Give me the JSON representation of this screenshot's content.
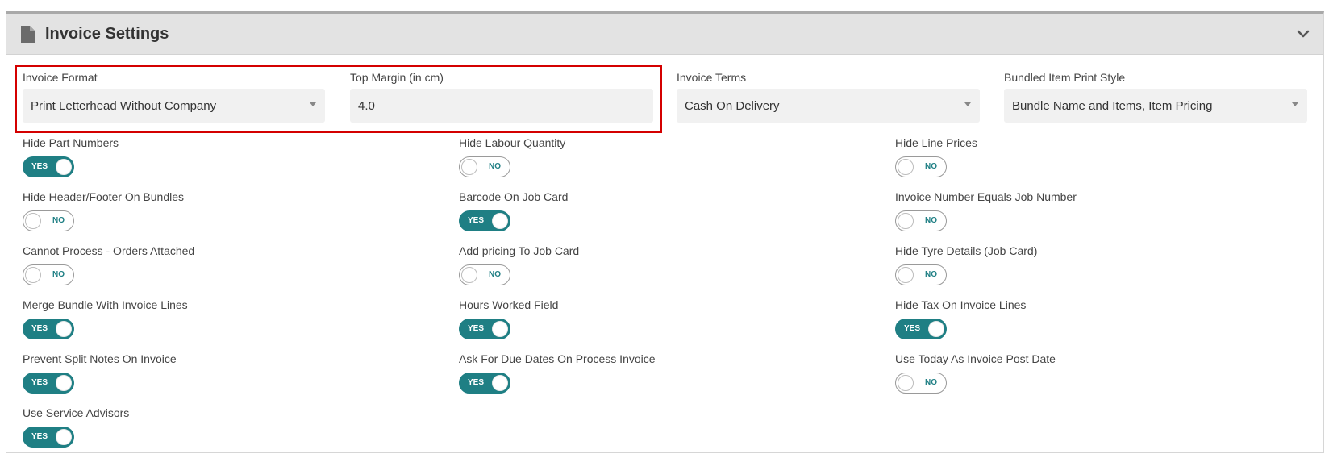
{
  "panel": {
    "title": "Invoice Settings",
    "icons": {
      "header": "document-icon",
      "collapse": "chevron-down-icon"
    }
  },
  "fields": {
    "invoice_format": {
      "label": "Invoice Format",
      "value": "Print Letterhead Without Company"
    },
    "top_margin": {
      "label": "Top Margin (in cm)",
      "value": "4.0"
    },
    "invoice_terms": {
      "label": "Invoice Terms",
      "value": "Cash On Delivery"
    },
    "bundled_print_style": {
      "label": "Bundled Item Print Style",
      "value": "Bundle Name and Items, Item Pricing"
    }
  },
  "toggles": [
    {
      "label": "Hide Part Numbers",
      "state": "YES"
    },
    {
      "label": "Hide Labour Quantity",
      "state": "NO"
    },
    {
      "label": "Hide Line Prices",
      "state": "NO"
    },
    {
      "label": "Hide Header/Footer On Bundles",
      "state": "NO"
    },
    {
      "label": "Barcode On Job Card",
      "state": "YES"
    },
    {
      "label": "Invoice Number Equals Job Number",
      "state": "NO"
    },
    {
      "label": "Cannot Process - Orders Attached",
      "state": "NO"
    },
    {
      "label": "Add pricing To Job Card",
      "state": "NO"
    },
    {
      "label": "Hide Tyre Details (Job Card)",
      "state": "NO"
    },
    {
      "label": "Merge Bundle With Invoice Lines",
      "state": "YES"
    },
    {
      "label": "Hours Worked Field",
      "state": "YES"
    },
    {
      "label": "Hide Tax On Invoice Lines",
      "state": "YES"
    },
    {
      "label": "Prevent Split Notes On Invoice",
      "state": "YES"
    },
    {
      "label": "Ask For Due Dates On Process Invoice",
      "state": "YES"
    },
    {
      "label": "Use Today As Invoice Post Date",
      "state": "NO"
    },
    {
      "label": "Use Service Advisors",
      "state": "YES"
    }
  ],
  "colors": {
    "accent": "#1f7f84",
    "highlight": "#d40000",
    "header_bg": "#e3e3e3"
  }
}
